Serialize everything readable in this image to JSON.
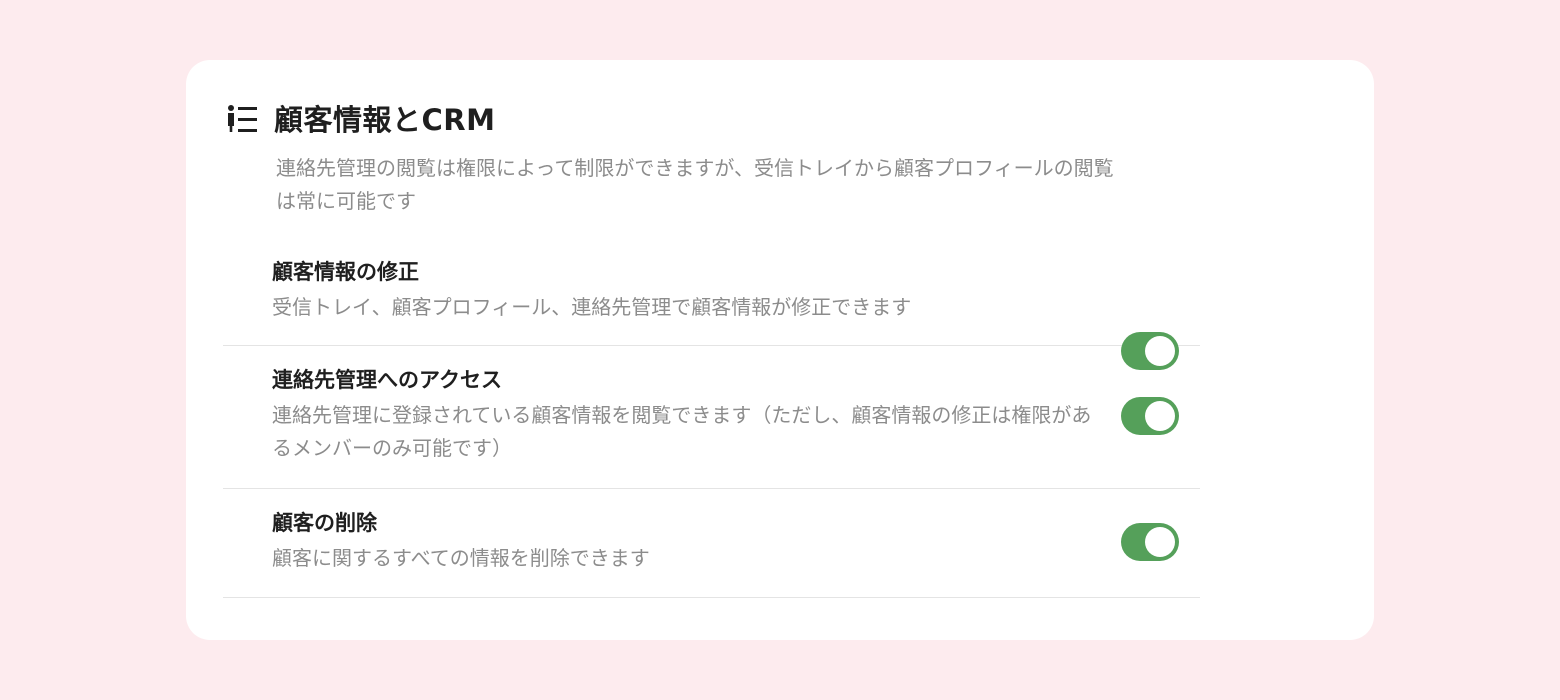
{
  "section": {
    "icon": "person-list-icon",
    "title": "顧客情報とCRM",
    "description": "連絡先管理の閲覧は権限によって制限ができますが、受信トレイから顧客プロフィールの閲覧は常に可能です"
  },
  "settings": [
    {
      "title": "顧客情報の修正",
      "description": "受信トレイ、顧客プロフィール、連絡先管理で顧客情報が修正できます",
      "enabled": true
    },
    {
      "title": "連絡先管理へのアクセス",
      "description": "連絡先管理に登録されている顧客情報を閲覧できます（ただし、顧客情報の修正は権限があるメンバーのみ可能です）",
      "enabled": true
    },
    {
      "title": "顧客の削除",
      "description": "顧客に関するすべての情報を削除できます",
      "enabled": true
    }
  ],
  "colors": {
    "page_background": "#fdebee",
    "toggle_on": "#55a05a",
    "title_text": "#1f1f1f",
    "secondary_text": "#8c8c8c"
  }
}
